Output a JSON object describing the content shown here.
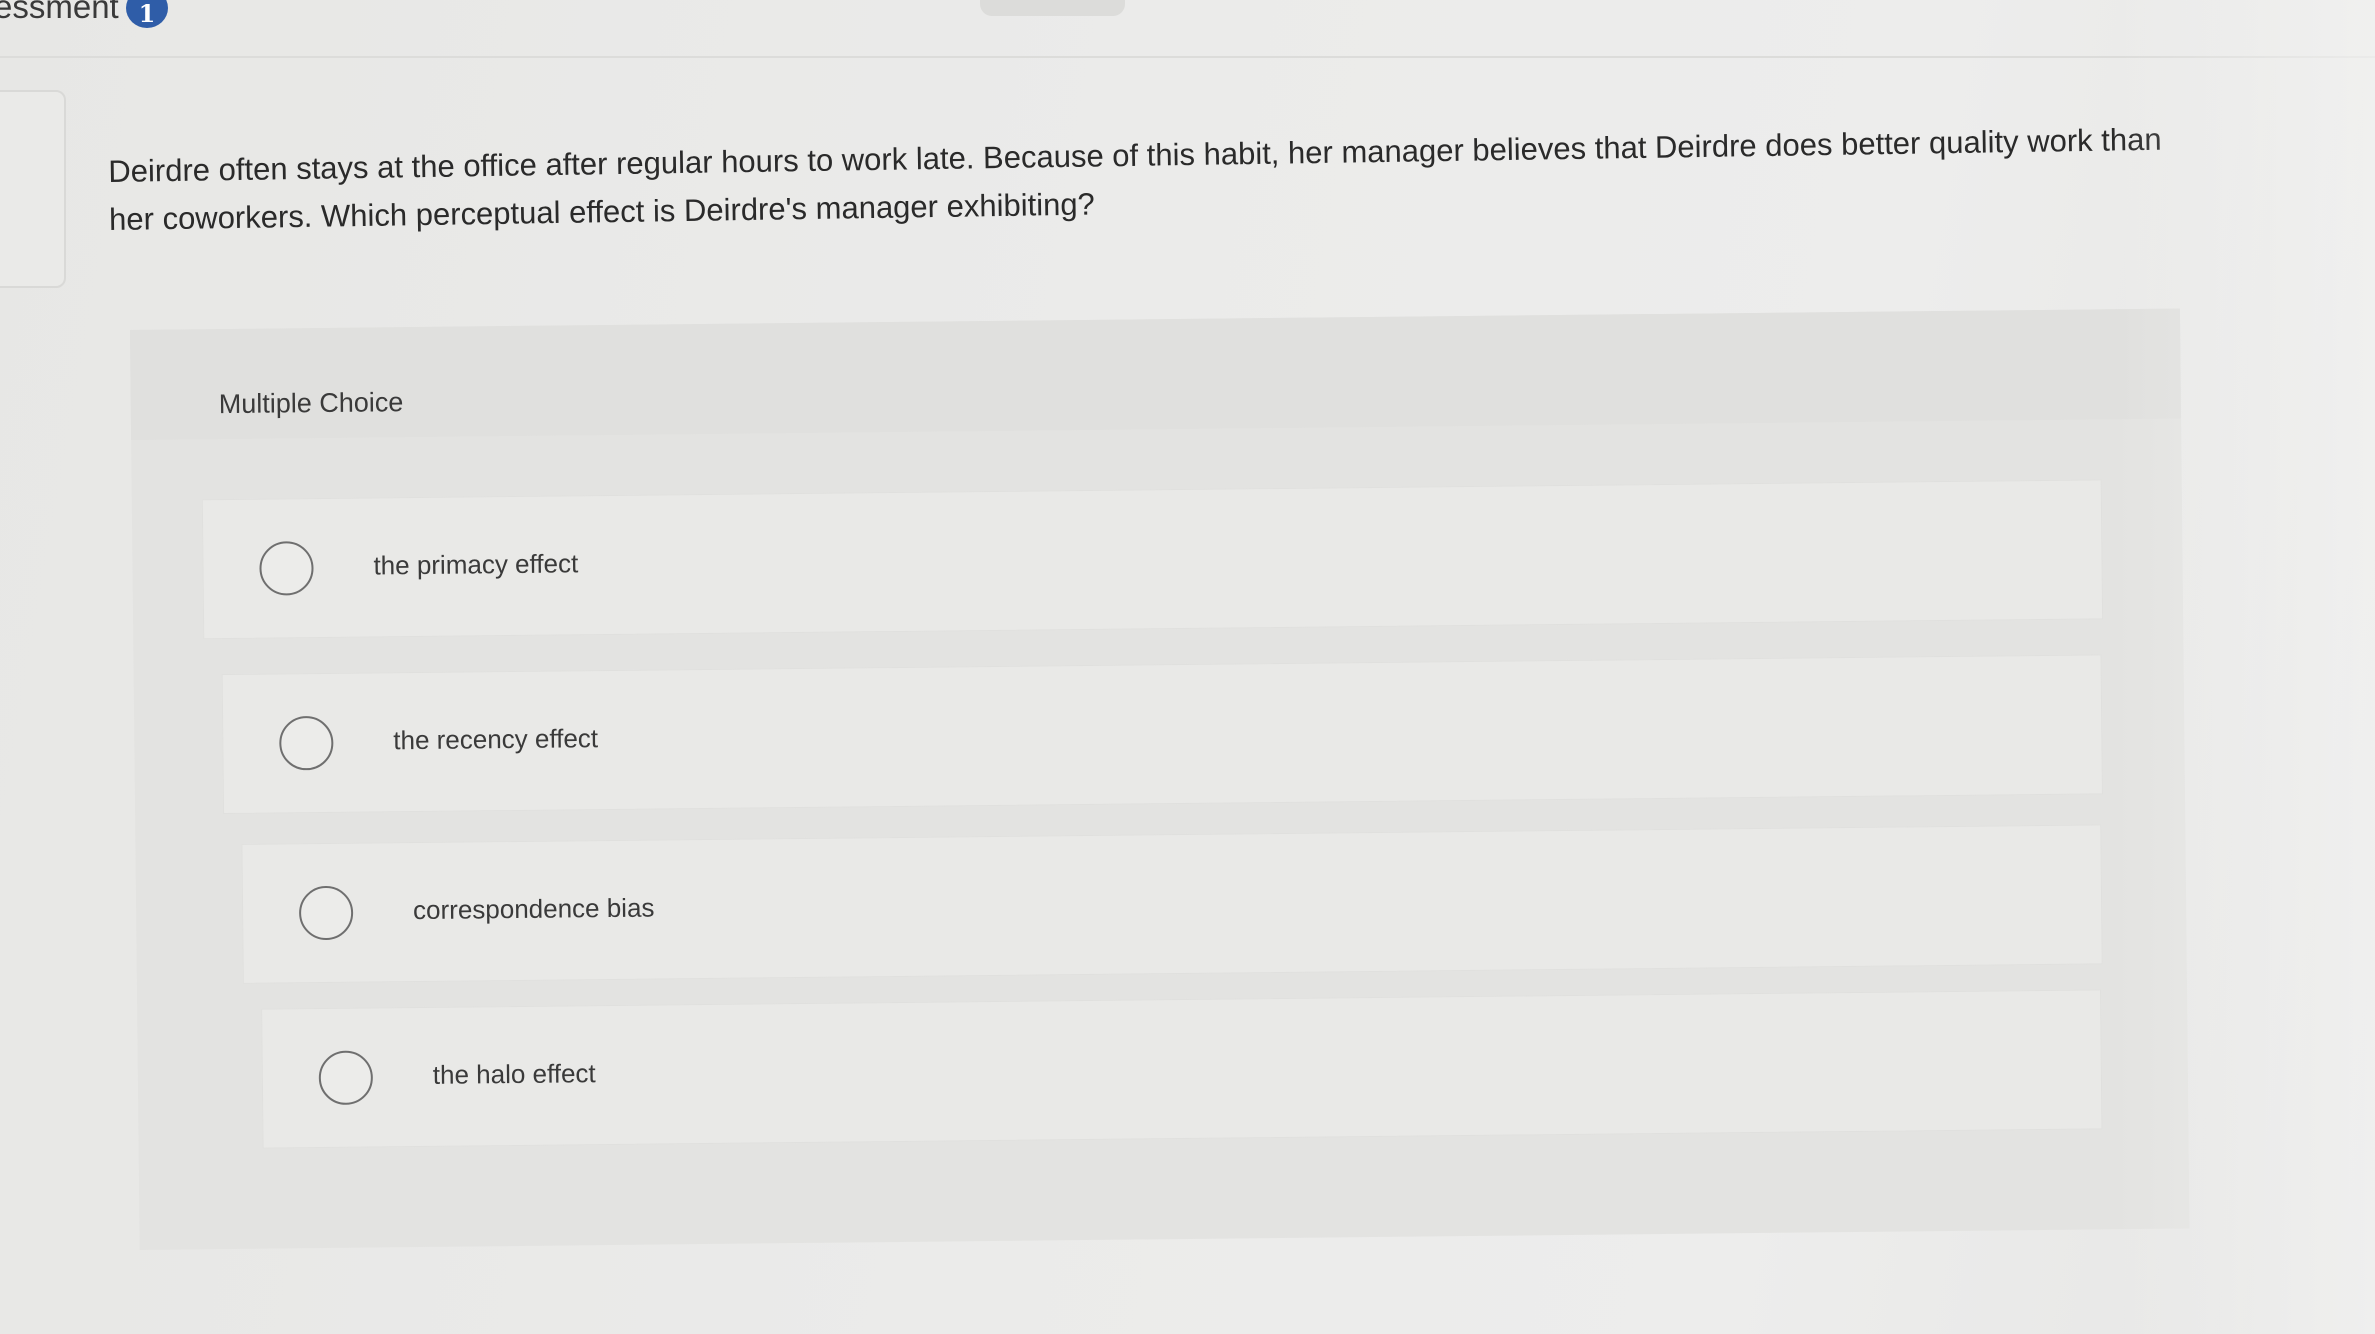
{
  "header": {
    "title": "essment",
    "badge": "1"
  },
  "question": {
    "text": "Deirdre often stays at the office after regular hours to work late. Because of this habit, her manager believes that Deirdre does better quality work than her coworkers. Which perceptual effect is Deirdre's manager exhibiting?"
  },
  "answers": {
    "type_label": "Multiple Choice",
    "options": [
      {
        "label": "the primacy effect"
      },
      {
        "label": "the recency effect"
      },
      {
        "label": "correspondence bias"
      },
      {
        "label": "the halo effect"
      }
    ]
  },
  "colors": {
    "badge": "#2f5da8",
    "background": "#ebebea",
    "panel": "#e3e3e1"
  }
}
